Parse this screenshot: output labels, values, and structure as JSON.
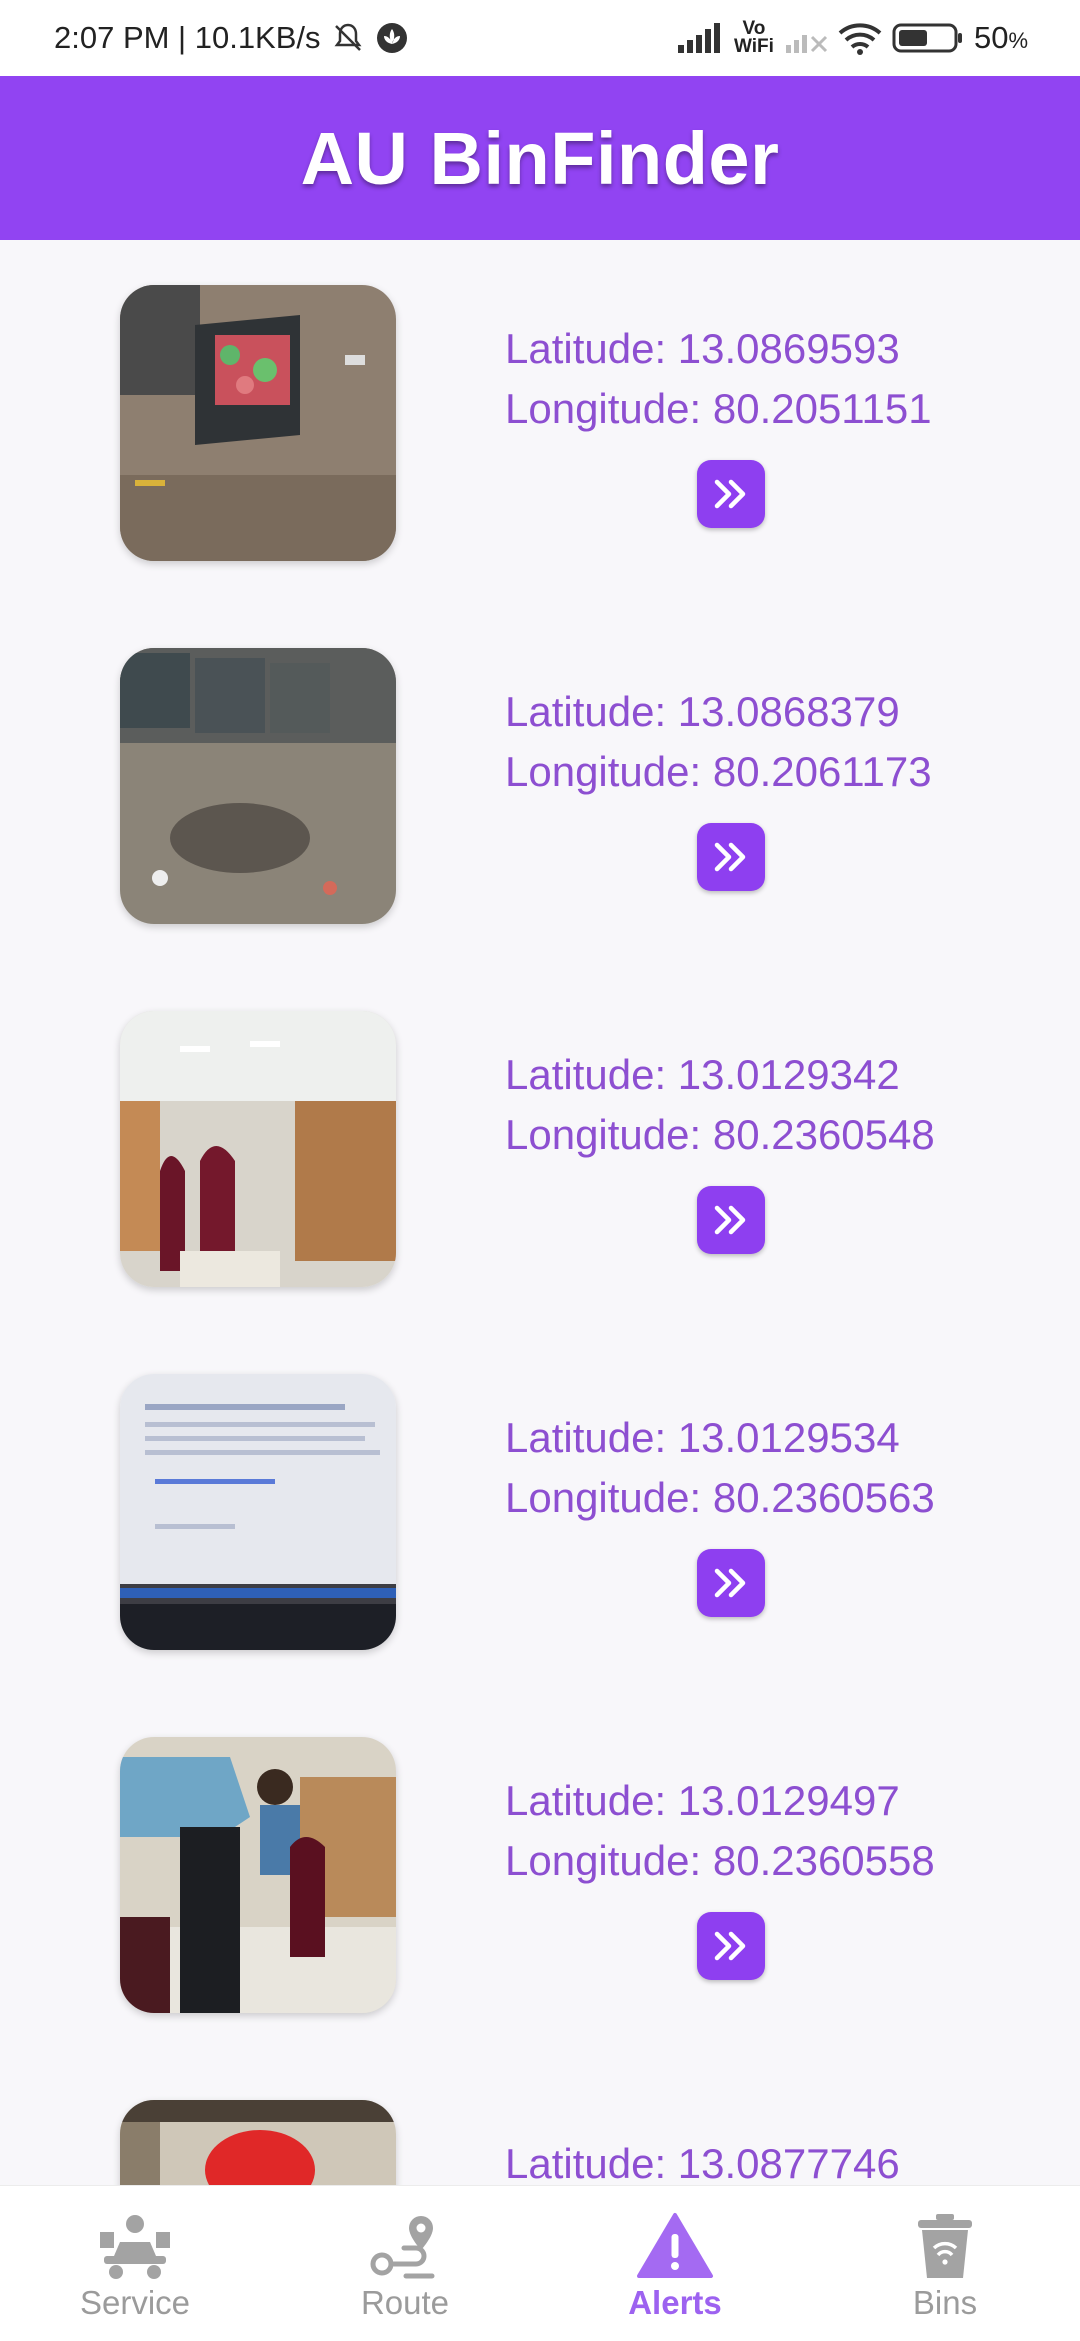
{
  "status_bar": {
    "time_speed": "2:07 PM | 10.1KB/s",
    "vowifi_top": "Vo",
    "vowifi_bottom": "WiFi",
    "battery": "50"
  },
  "app": {
    "title": "AU BinFinder"
  },
  "alerts": [
    {
      "latitude": "Latitude: 13.0869593",
      "longitude": "Longitude: 80.2051151",
      "photo": "crate-with-watermelon-rinds"
    },
    {
      "latitude": "Latitude: 13.0868379",
      "longitude": "Longitude: 80.2061173",
      "photo": "dumpsters-and-littered-ground"
    },
    {
      "latitude": "Latitude: 13.0129342",
      "longitude": "Longitude: 80.2360548",
      "photo": "office-room-with-chairs"
    },
    {
      "latitude": "Latitude: 13.0129534",
      "longitude": "Longitude: 80.2360563",
      "photo": "laptop-screen"
    },
    {
      "latitude": "Latitude: 13.0129497",
      "longitude": "Longitude: 80.2360558",
      "photo": "people-in-office"
    },
    {
      "latitude": "Latitude: 13.0877746",
      "longitude": "",
      "photo": "wall-and-red-object"
    }
  ],
  "bottom_nav": [
    {
      "label": "Service",
      "icon": "service-icon",
      "active": false
    },
    {
      "label": "Route",
      "icon": "route-icon",
      "active": false
    },
    {
      "label": "Alerts",
      "icon": "alert-icon",
      "active": true
    },
    {
      "label": "Bins",
      "icon": "bin-icon",
      "active": false
    }
  ],
  "colors": {
    "primary": "#9144f2",
    "text_purple": "#8d4fd1",
    "nav_active": "#9d62f0",
    "nav_inactive": "#9b9b9b"
  }
}
